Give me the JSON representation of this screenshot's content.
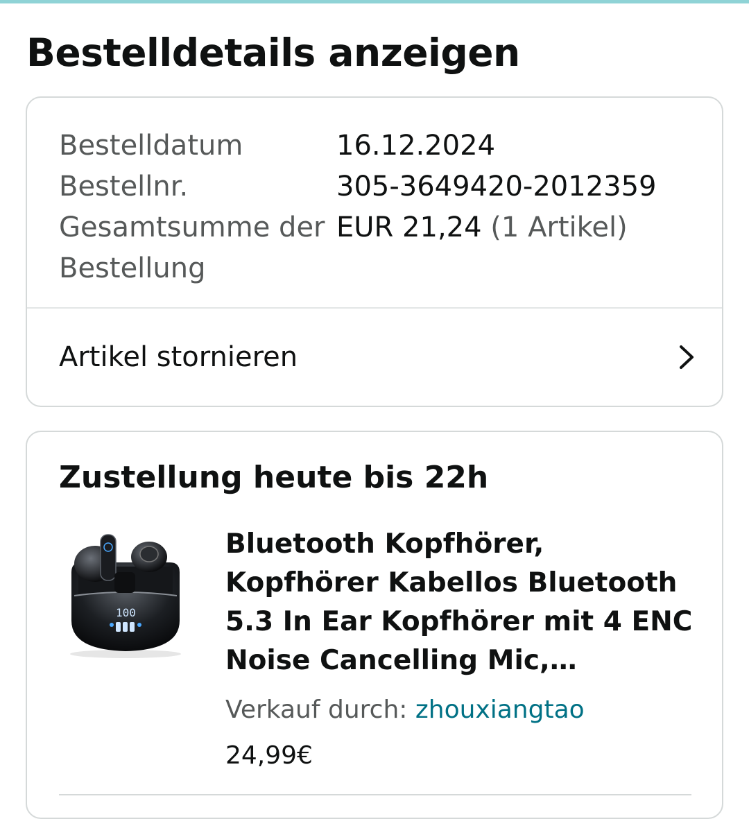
{
  "header": {
    "title": "Bestelldetails anzeigen"
  },
  "summary": {
    "rows": [
      {
        "label": "Bestelldatum",
        "value": "16.12.2024"
      },
      {
        "label": "Bestellnr.",
        "value": "305-3649420-2012359"
      },
      {
        "label": "Gesamtsumme der Bestellung",
        "value": "EUR 21,24",
        "extra": "(1 Artikel)"
      }
    ],
    "cancel_link": {
      "label": "Artikel stornieren",
      "icon": "chevron-right-icon"
    }
  },
  "delivery": {
    "title": "Zustellung heute bis 22h",
    "item": {
      "image_icon": "earbuds-product-image",
      "title": "Bluetooth Kopfhörer, Kopfhörer Kabellos Bluetooth 5.3 In Ear Kopfhörer mit 4 ENC Noise Cancelling Mic, Kabellose Kopf…",
      "seller_label": "Verkauf durch:",
      "seller_name": "zhouxiangtao",
      "price": "24,99€"
    }
  },
  "colors": {
    "text": "#0f1111",
    "secondary_text": "#565959",
    "link": "#007185",
    "border": "#d5d9d9",
    "top_accent": "#8fd3d6"
  }
}
